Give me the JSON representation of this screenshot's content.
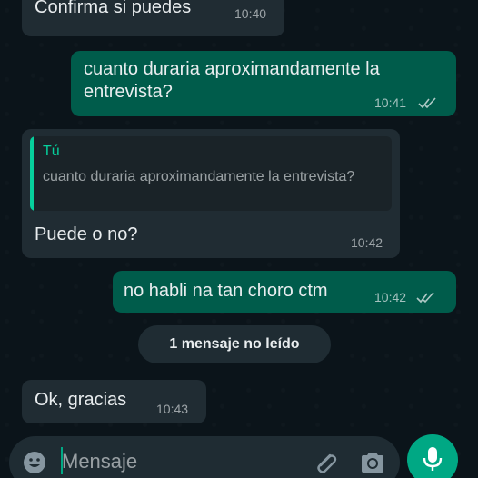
{
  "colors": {
    "background": "#0b141a",
    "incoming_bubble": "#202c33",
    "outgoing_bubble": "#005c4b",
    "accent": "#00a884",
    "quote_author": "#06cf9c"
  },
  "messages": [
    {
      "direction": "incoming",
      "text": "Confirma si puedes",
      "time": "10:40"
    },
    {
      "direction": "outgoing",
      "text": "cuanto duraria aproximandamente la entrevista?",
      "time": "10:41",
      "status": "read-ticks"
    },
    {
      "direction": "incoming",
      "quote": {
        "author": "Tú",
        "text": "cuanto duraria aproximandamente la entrevista?"
      },
      "text": "Puede o no?",
      "time": "10:42"
    },
    {
      "direction": "outgoing",
      "text": "no habli na tan choro ctm",
      "time": "10:42",
      "status": "read-ticks"
    },
    {
      "direction": "incoming",
      "text": "Ok, gracias",
      "time": "10:43"
    }
  ],
  "unread_banner": "1 mensaje no leído",
  "composer": {
    "placeholder": "Mensaje",
    "icons": [
      "emoji-icon",
      "attach-icon",
      "camera-icon",
      "mic-icon"
    ]
  }
}
